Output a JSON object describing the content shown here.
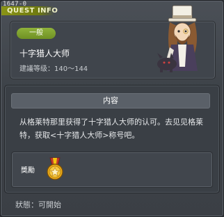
{
  "window": {
    "quest_id": "1647-0",
    "title": "QUEST INFO"
  },
  "header": {
    "category": "一般",
    "quest_name": "十字猎人大师",
    "level_range": "建議等级：140～144"
  },
  "content": {
    "heading": "内容",
    "description": "从格莱特那里获得了十字猎人大师的认可。去见见格莱特，获取<十字猎人大师>称号吧。"
  },
  "reward": {
    "label": "獎勵",
    "icon": "medal-icon"
  },
  "status": {
    "text": "狀態：可開始"
  },
  "colors": {
    "title_accent": "#8a9416",
    "category_pill": "#7fa02e",
    "panel_bg": "#40454c"
  }
}
